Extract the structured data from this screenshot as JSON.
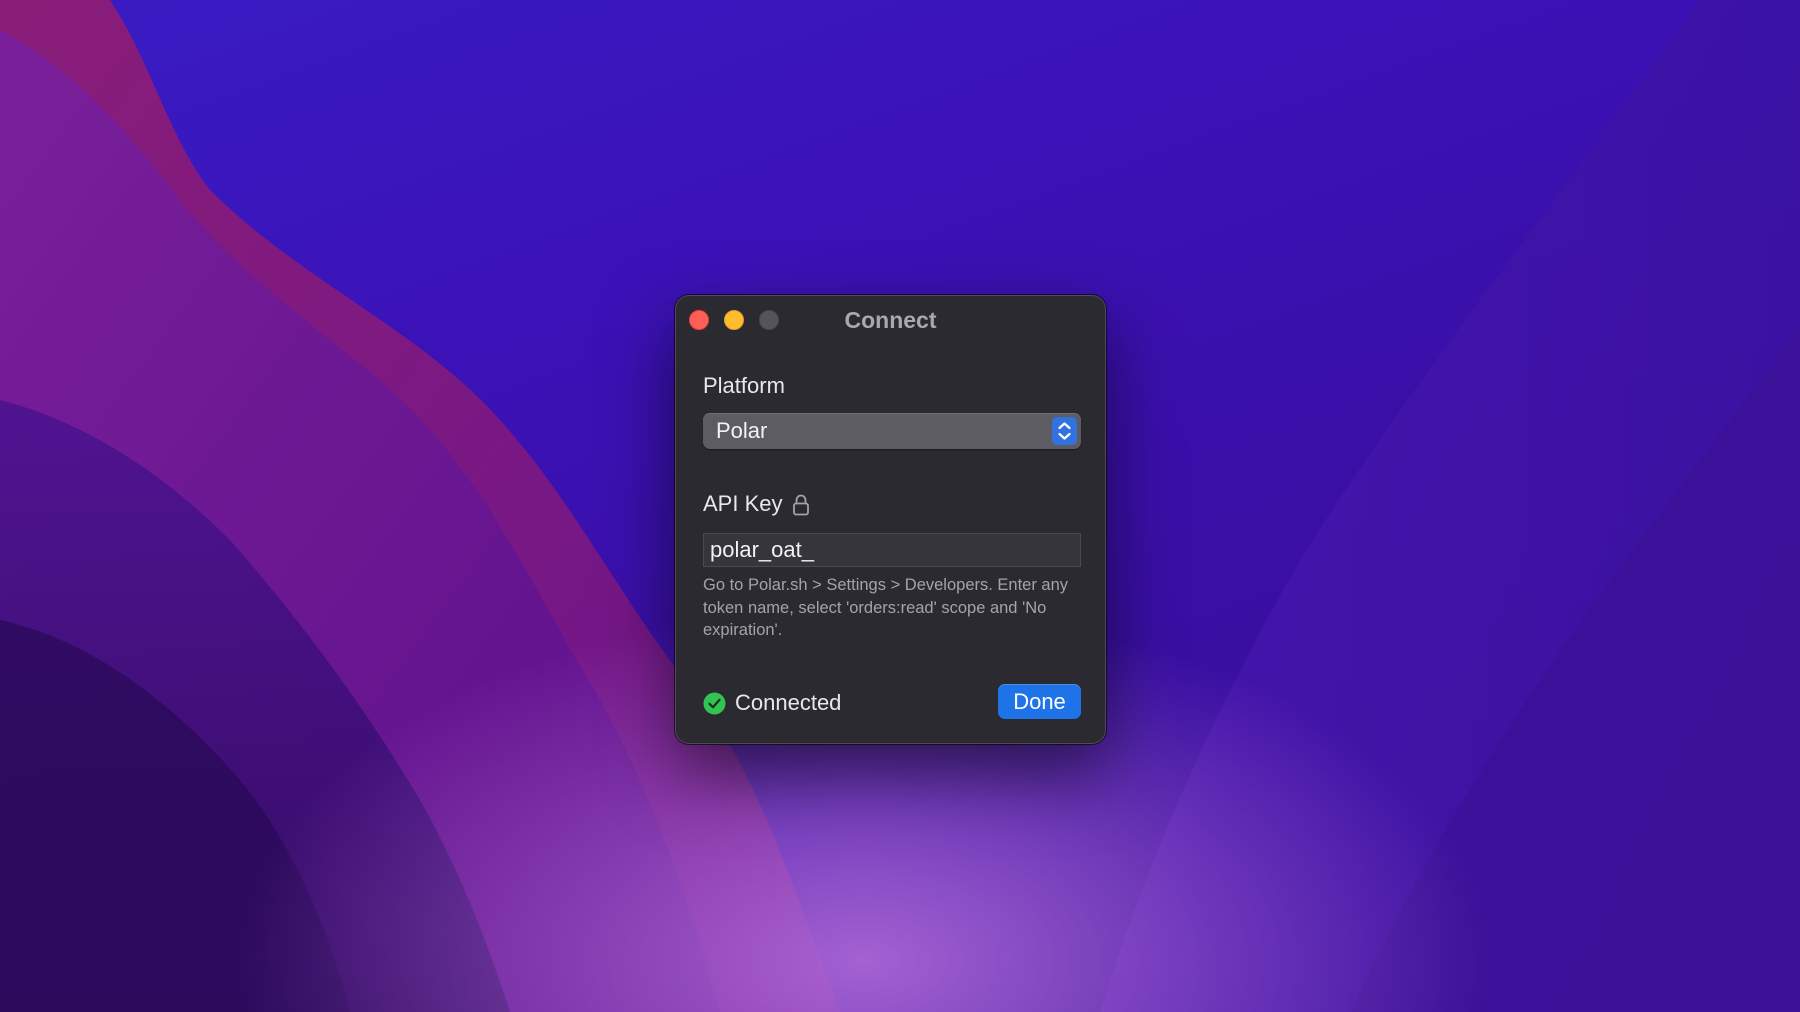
{
  "window": {
    "title": "Connect"
  },
  "form": {
    "platform_label": "Platform",
    "platform_value": "Polar",
    "api_key_label": "API Key",
    "api_key_value": "polar_oat_",
    "help_text": "Go to Polar.sh > Settings > Developers. Enter any token name, select 'orders:read' scope and 'No expiration'."
  },
  "footer": {
    "status": "Connected",
    "done_label": "Done"
  },
  "colors": {
    "accent": "#1f73e8",
    "success": "#30c452",
    "close": "#ff5f57",
    "minimize": "#febc2e"
  },
  "icons": {
    "lock": "lock-icon",
    "status": "check-circle-icon",
    "stepper": "chevron-up-down-icon"
  }
}
